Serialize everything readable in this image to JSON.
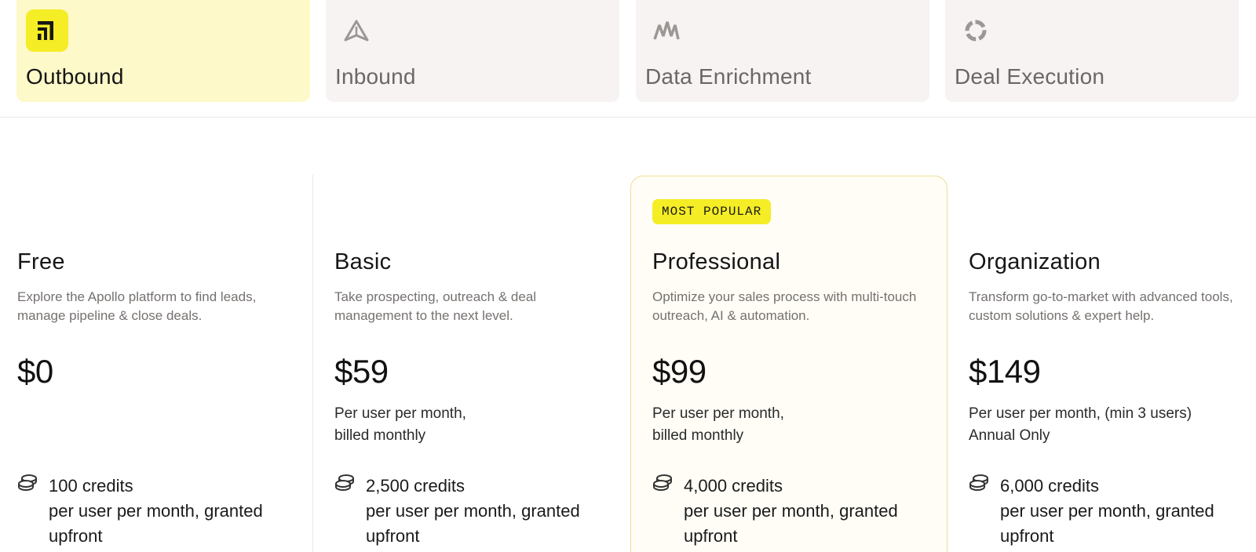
{
  "tabs": [
    {
      "label": "Outbound",
      "icon": "outbound-icon",
      "active": true
    },
    {
      "label": "Inbound",
      "icon": "inbound-icon",
      "active": false
    },
    {
      "label": "Data Enrichment",
      "icon": "data-enrichment-icon",
      "active": false
    },
    {
      "label": "Deal Execution",
      "icon": "deal-execution-icon",
      "active": false
    }
  ],
  "plans": [
    {
      "name": "Free",
      "badge": "",
      "description": "Explore the Apollo platform to find leads, manage pipeline & close deals.",
      "price": "$0",
      "billing_line1": "",
      "billing_line2": "",
      "credits_amount": "100 credits",
      "credits_detail": "per user per month, granted upfront"
    },
    {
      "name": "Basic",
      "badge": "",
      "description": "Take prospecting, outreach & deal management to the next level.",
      "price": "$59",
      "billing_line1": "Per user per month,",
      "billing_line2": "billed monthly",
      "credits_amount": "2,500 credits",
      "credits_detail": "per user per month, granted upfront"
    },
    {
      "name": "Professional",
      "badge": "MOST POPULAR",
      "description": "Optimize your sales process with multi-touch outreach, AI & automation.",
      "price": "$99",
      "billing_line1": "Per user per month,",
      "billing_line2": "billed monthly",
      "credits_amount": "4,000 credits",
      "credits_detail": "per user per month, granted upfront"
    },
    {
      "name": "Organization",
      "badge": "",
      "description": "Transform go-to-market with advanced tools, custom solutions & expert help.",
      "price": "$149",
      "billing_line1": "Per user per month, (min 3 users)",
      "billing_line2": "Annual Only",
      "credits_amount": "6,000 credits",
      "credits_detail": "per user per month, granted upfront"
    }
  ],
  "colors": {
    "accent_yellow": "#f5ed25",
    "active_tab_bg": "#fdf9c9",
    "inactive_tab_bg": "#f6f3f2",
    "highlight_border": "#ecdf95"
  }
}
